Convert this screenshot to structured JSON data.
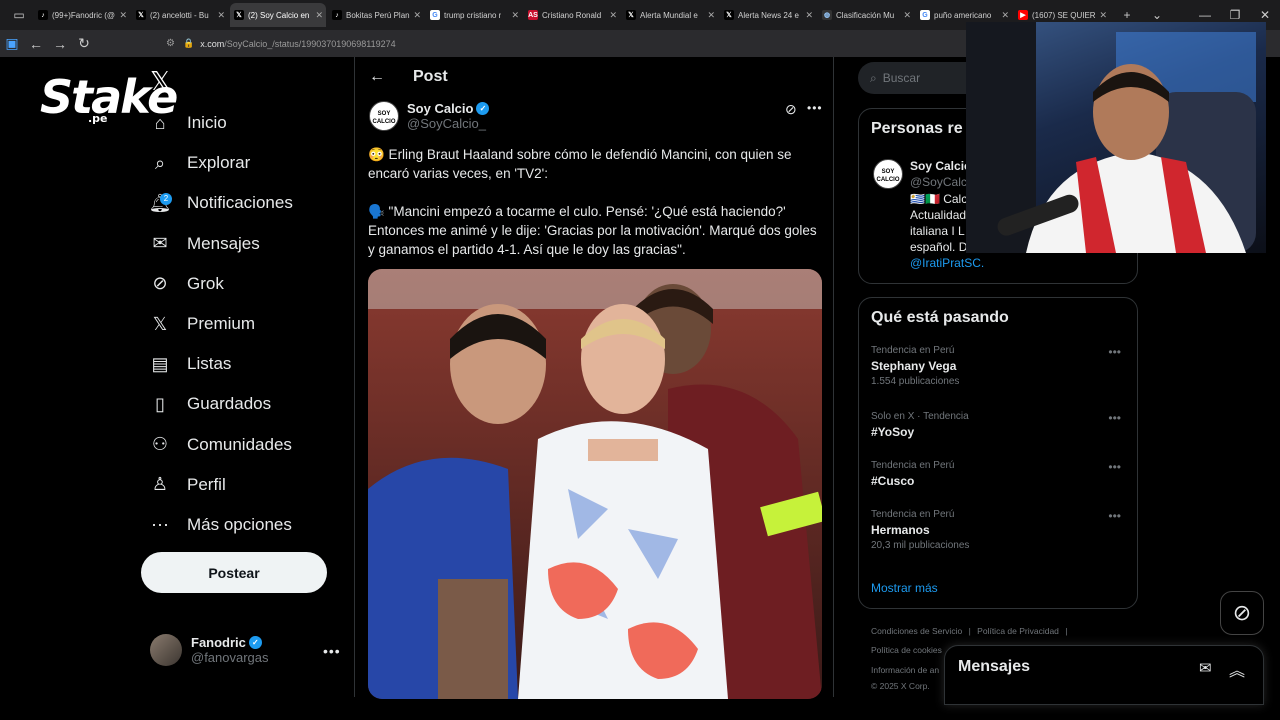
{
  "browser": {
    "tabs": [
      {
        "label": "(99+)Fanodric (@",
        "icon": "tiktok-icon",
        "active": false
      },
      {
        "label": "(2) ancelotti - Bu",
        "icon": "x-icon",
        "active": false
      },
      {
        "label": "(2) Soy Calcio en",
        "icon": "x-icon",
        "active": true
      },
      {
        "label": "Bokitas Perú Plan",
        "icon": "tiktok-icon",
        "active": false
      },
      {
        "label": "trump cristiano r",
        "icon": "google-icon",
        "active": false
      },
      {
        "label": "Cristiano Ronald",
        "icon": "as-icon",
        "active": false
      },
      {
        "label": "Alerta Mundial e",
        "icon": "x-icon",
        "active": false
      },
      {
        "label": "Alerta News 24 e",
        "icon": "x-icon",
        "active": false
      },
      {
        "label": "Clasificación Mu",
        "icon": "globe-icon",
        "active": false
      },
      {
        "label": "puño americano",
        "icon": "google-icon",
        "active": false
      },
      {
        "label": "(1607) SE QUIER",
        "icon": "youtube-icon",
        "active": false
      }
    ],
    "url_domain": "x.com",
    "url_path": "/SoyCalcio_/status/1990370190698119274"
  },
  "overlay": {
    "logo_text": "Stake",
    "logo_suffix": ".pe"
  },
  "nav": {
    "items": [
      {
        "label": "Inicio",
        "icon": "home-icon"
      },
      {
        "label": "Explorar",
        "icon": "search-icon"
      },
      {
        "label": "Notificaciones",
        "icon": "bell-icon",
        "badge": "2"
      },
      {
        "label": "Mensajes",
        "icon": "mail-icon"
      },
      {
        "label": "Grok",
        "icon": "grok-icon"
      },
      {
        "label": "Premium",
        "icon": "x-icon"
      },
      {
        "label": "Listas",
        "icon": "list-icon"
      },
      {
        "label": "Guardados",
        "icon": "bookmark-icon"
      },
      {
        "label": "Comunidades",
        "icon": "people-icon"
      },
      {
        "label": "Perfil",
        "icon": "person-icon"
      },
      {
        "label": "Más opciones",
        "icon": "more-circle-icon"
      }
    ],
    "post_button": "Postear",
    "account": {
      "name": "Fanodric",
      "handle": "@fanovargas"
    }
  },
  "post": {
    "header": "Post",
    "author_name": "Soy Calcio",
    "author_handle": "@SoyCalcio_",
    "avatar_text": "SOY CALCIO",
    "text_1": "😳 Erling Braut Haaland sobre cómo le defendió Mancini, con quien se encaró varias veces, en 'TV2':",
    "text_2": "🗣️ \"Mancini empezó a tocarme el culo. Pensé: '¿Qué está haciendo?' Entonces me animé y le dije: 'Gracias por la motivación'. Marqué dos goles y ganamos el partido 4-1. Así que le doy las gracias\"."
  },
  "right": {
    "search_placeholder": "Buscar",
    "relevant_title": "Personas re",
    "relevant_name": "Soy Calcio",
    "relevant_handle": "@SoyCalc",
    "relevant_bio_1": "🇺🇾🇮🇹 Calc",
    "relevant_bio_2": "Actualidad",
    "relevant_bio_3": "italiana I L",
    "relevant_bio_4": "español. D",
    "relevant_mention": "@IratiPratSC.",
    "trending_title": "Qué está pasando",
    "trends": [
      {
        "meta": "Tendencia en Perú",
        "name": "Stephany Vega",
        "count": "1.554 publicaciones"
      },
      {
        "meta": "Solo en X · Tendencia",
        "name": "#YoSoy",
        "count": ""
      },
      {
        "meta": "Tendencia en Perú",
        "name": "#Cusco",
        "count": ""
      },
      {
        "meta": "Tendencia en Perú",
        "name": "Hermanos",
        "count": "20,3 mil publicaciones"
      }
    ],
    "show_more": "Mostrar más",
    "footer": {
      "terms": "Condiciones de Servicio",
      "privacy": "Política de Privacidad",
      "cookies": "Política de cookies",
      "info": "Información de an",
      "copyright": "© 2025 X Corp."
    }
  },
  "messages_drawer": {
    "title": "Mensajes"
  },
  "colors": {
    "accent": "#1d9bf0",
    "background": "#000000",
    "border": "#2f3336"
  }
}
